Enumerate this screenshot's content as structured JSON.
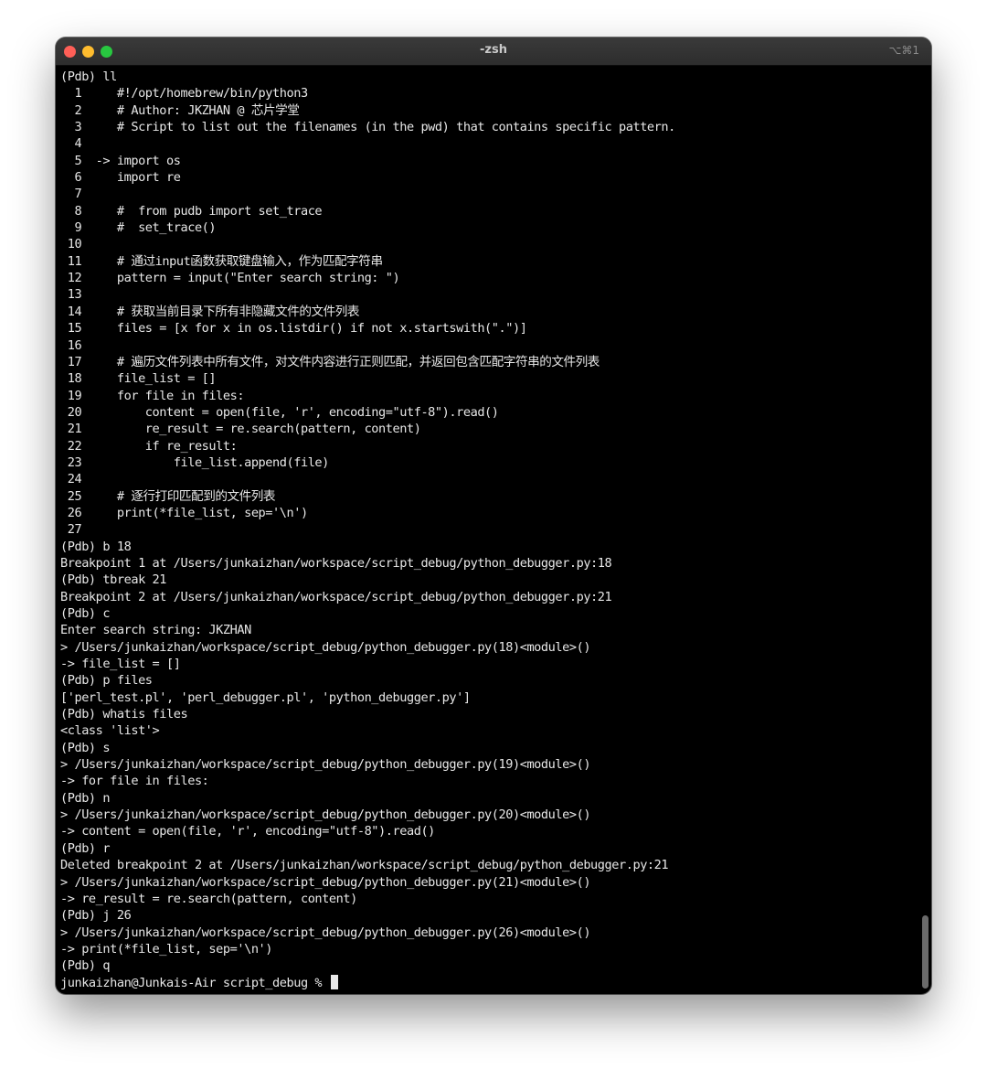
{
  "window": {
    "title": "-zsh",
    "shortcut": "⌥⌘1"
  },
  "lines": [
    "(Pdb) ll",
    "  1     #!/opt/homebrew/bin/python3",
    "  2     # Author: JKZHAN @ 芯片学堂",
    "  3     # Script to list out the filenames (in the pwd) that contains specific pattern.",
    "  4",
    "  5  -> import os",
    "  6     import re",
    "  7",
    "  8     #  from pudb import set_trace",
    "  9     #  set_trace()",
    " 10",
    " 11     # 通过input函数获取键盘输入，作为匹配字符串",
    " 12     pattern = input(\"Enter search string: \")",
    " 13",
    " 14     # 获取当前目录下所有非隐藏文件的文件列表",
    " 15     files = [x for x in os.listdir() if not x.startswith(\".\")]",
    " 16",
    " 17     # 遍历文件列表中所有文件，对文件内容进行正则匹配，并返回包含匹配字符串的文件列表",
    " 18     file_list = []",
    " 19     for file in files:",
    " 20         content = open(file, 'r', encoding=\"utf-8\").read()",
    " 21         re_result = re.search(pattern, content)",
    " 22         if re_result:",
    " 23             file_list.append(file)",
    " 24",
    " 25     # 逐行打印匹配到的文件列表",
    " 26     print(*file_list, sep='\\n')",
    " 27",
    "(Pdb) b 18",
    "Breakpoint 1 at /Users/junkaizhan/workspace/script_debug/python_debugger.py:18",
    "(Pdb) tbreak 21",
    "Breakpoint 2 at /Users/junkaizhan/workspace/script_debug/python_debugger.py:21",
    "(Pdb) c",
    "Enter search string: JKZHAN",
    "> /Users/junkaizhan/workspace/script_debug/python_debugger.py(18)<module>()",
    "-> file_list = []",
    "(Pdb) p files",
    "['perl_test.pl', 'perl_debugger.pl', 'python_debugger.py']",
    "(Pdb) whatis files",
    "<class 'list'>",
    "(Pdb) s",
    "> /Users/junkaizhan/workspace/script_debug/python_debugger.py(19)<module>()",
    "-> for file in files:",
    "(Pdb) n",
    "> /Users/junkaizhan/workspace/script_debug/python_debugger.py(20)<module>()",
    "-> content = open(file, 'r', encoding=\"utf-8\").read()",
    "(Pdb) r",
    "Deleted breakpoint 2 at /Users/junkaizhan/workspace/script_debug/python_debugger.py:21",
    "> /Users/junkaizhan/workspace/script_debug/python_debugger.py(21)<module>()",
    "-> re_result = re.search(pattern, content)",
    "(Pdb) j 26",
    "> /Users/junkaizhan/workspace/script_debug/python_debugger.py(26)<module>()",
    "-> print(*file_list, sep='\\n')",
    "(Pdb) q"
  ],
  "prompt": "junkaizhan@Junkais-Air script_debug % "
}
